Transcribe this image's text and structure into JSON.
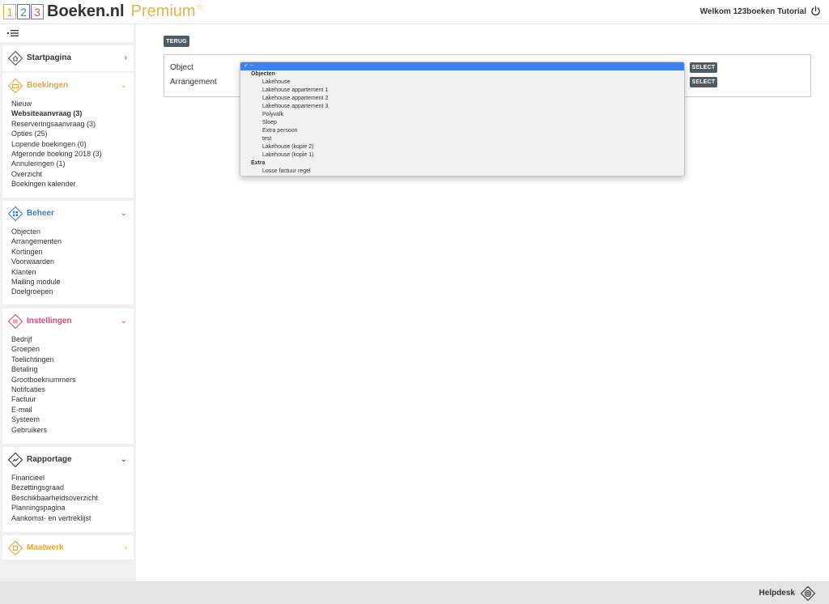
{
  "header": {
    "logo_digits": [
      "1",
      "2",
      "3"
    ],
    "brand": "Boeken.nl",
    "premium": "Premium",
    "star": "☆",
    "welcome": "Welkom 123boeken Tutorial"
  },
  "sidebar": {
    "startpagina": {
      "title": "Startpagina",
      "chevron": "›"
    },
    "boekingen": {
      "title": "Boekingen",
      "chevron": "⌄",
      "color": "#e8a33d",
      "items": [
        "Nieuw",
        "Websiteaanvraag (3)",
        "Reserveringsaanvraag (3)",
        "Opties (25)",
        "Lopende boekingen (0)",
        "Afgeronde boeking 2018 (3)",
        "Annuleringen (1)",
        "Overzicht",
        "Boekingen kalender"
      ]
    },
    "beheer": {
      "title": "Beheer",
      "chevron": "⌄",
      "color": "#3b7dc4",
      "items": [
        "Objecten",
        "Arrangementen",
        "Kortingen",
        "Voorwaarden",
        "Klanten",
        "Mailing module",
        "Doelgroepen"
      ]
    },
    "instellingen": {
      "title": "Instellingen",
      "chevron": "⌄",
      "color": "#d64a7a",
      "items": [
        "Bedrijf",
        "Groepen",
        "Toelichtingen",
        "Betaling",
        "Grootboeknummers",
        "Notifcaties",
        "Factuur",
        "E-mail",
        "Systeem",
        "Gebruikers"
      ]
    },
    "rapportage": {
      "title": "Rapportage",
      "chevron": "⌄",
      "color": "#333333",
      "items": [
        "Financieel",
        "Bezettingsgraad",
        "Beschikbaarheidsoverzicht",
        "Planningspagina",
        "Aankomst- en vertreklijst"
      ]
    },
    "maatwerk": {
      "title": "Maatwerk",
      "chevron": "›",
      "color": "#e8a33d"
    }
  },
  "main": {
    "back_button": "TERUG",
    "object_label": "Object",
    "arrangement_label": "Arrangement",
    "select_button": "SELECT"
  },
  "dropdown": {
    "selected": "✓ --",
    "groups": [
      {
        "label": "Objecten",
        "options": [
          "Lakehouse",
          "Lakehouse appartement 1",
          "Lakehouse appartement 2",
          "Lakehouse appartement 3",
          "Polyvalk",
          "Sloep",
          "Extra persoon",
          "test",
          "Lakehouse (kopie 2)",
          "Lakehouse (kopie 1)"
        ]
      },
      {
        "label": "Extra",
        "options": [
          "Losse factuur regel"
        ]
      }
    ]
  },
  "footer": {
    "helpdesk": "Helpdesk"
  }
}
